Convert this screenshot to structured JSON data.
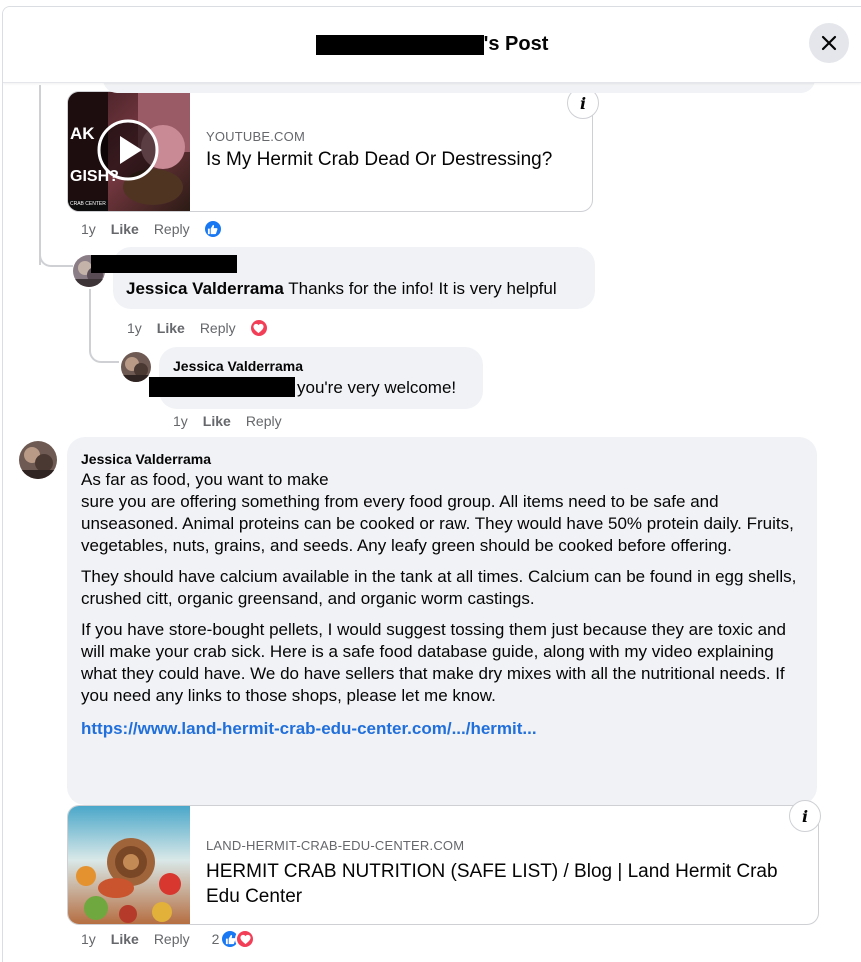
{
  "header": {
    "title_suffix": "'s Post"
  },
  "comments": {
    "youtube_card": {
      "domain": "YOUTUBE.COM",
      "title": "Is My Hermit Crab Dead Or Destressing?",
      "thumb_text_1": "AK",
      "thumb_text_2": "GISH?",
      "thumb_footer": "CRAB CENTER"
    },
    "youtube_actions": {
      "time": "1y",
      "like": "Like",
      "reply": "Reply"
    },
    "reply1": {
      "author": "Jessica Valderrama",
      "text": "Thanks for the info! It is very helpful",
      "actions": {
        "time": "1y",
        "like": "Like",
        "reply": "Reply"
      }
    },
    "reply2": {
      "author": "Jessica Valderrama",
      "text": "you're very welcome!",
      "actions": {
        "time": "1y",
        "like": "Like",
        "reply": "Reply"
      }
    },
    "main": {
      "author": "Jessica Valderrama",
      "para1_line1": "As far as food, you want to make",
      "para1_rest": "sure you are offering something from every food group. All items need to be safe and unseasoned. Animal proteins can be cooked or raw. They would have 50% protein daily. Fruits, vegetables, nuts, grains, and seeds. Any leafy green should be cooked before offering.",
      "para2": "They should have calcium available in the tank at all times. Calcium can be found in egg shells, crushed citt, organic greensand, and organic worm castings.",
      "para3": "If you have store-bought pellets, I would suggest tossing them just because they are toxic and will make your crab sick. Here is a safe food database guide, along with my video explaining what they could have. We do have sellers that make dry mixes with all the nutritional needs. If you need any links to those shops, please let me know.",
      "link": "https://www.land-hermit-crab-edu-center.com/.../hermit...",
      "card": {
        "domain": "LAND-HERMIT-CRAB-EDU-CENTER.COM",
        "title": "HERMIT CRAB NUTRITION (SAFE LIST) / Blog | Land Hermit Crab Edu Center"
      },
      "actions": {
        "time": "1y",
        "like": "Like",
        "reply": "Reply",
        "reaction_count": "2"
      }
    }
  },
  "colors": {
    "accent": "#1877f2",
    "love": "#f33e58",
    "bubble": "#f0f2f5",
    "link": "#216fdb"
  }
}
